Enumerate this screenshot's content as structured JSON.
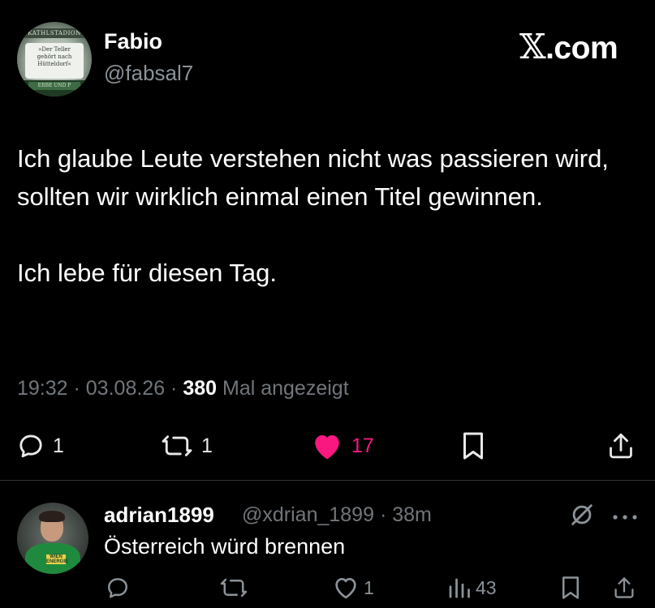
{
  "brand": {
    "logo_text": ".com",
    "logo_mark": "𝕏",
    "accent_like": "#f91880",
    "muted": "#71767b"
  },
  "tweet": {
    "author_name": "Fabio",
    "author_handle": "@fabsal7",
    "avatar": {
      "banner": "KATHLSTADION",
      "line1": "»Der Teller",
      "line2": "gehört nach",
      "line3": "Hütteldorf«",
      "band": "ERBE UND P"
    },
    "paragraph1": "Ich glaube Leute verstehen nicht was passieren wird, sollten wir wirklich einmal einen Titel gewinnen.",
    "paragraph2": "Ich lebe für diesen Tag.",
    "time": "19:32",
    "sep1": " · ",
    "date": "03.08.26",
    "sep2": " · ",
    "views_count": "380",
    "views_label": " Mal angezeigt",
    "actions": {
      "replies": "1",
      "reposts": "1",
      "likes": "17"
    }
  },
  "reply": {
    "author_name": "adrian1899",
    "author_handle": "@xdrian_1899",
    "dot": " · ",
    "time_ago": "38m",
    "text": "Österreich würd brennen",
    "avatar_shirt_text": "WIEN ENERGIE",
    "actions": {
      "likes": "1",
      "views": "43"
    }
  }
}
